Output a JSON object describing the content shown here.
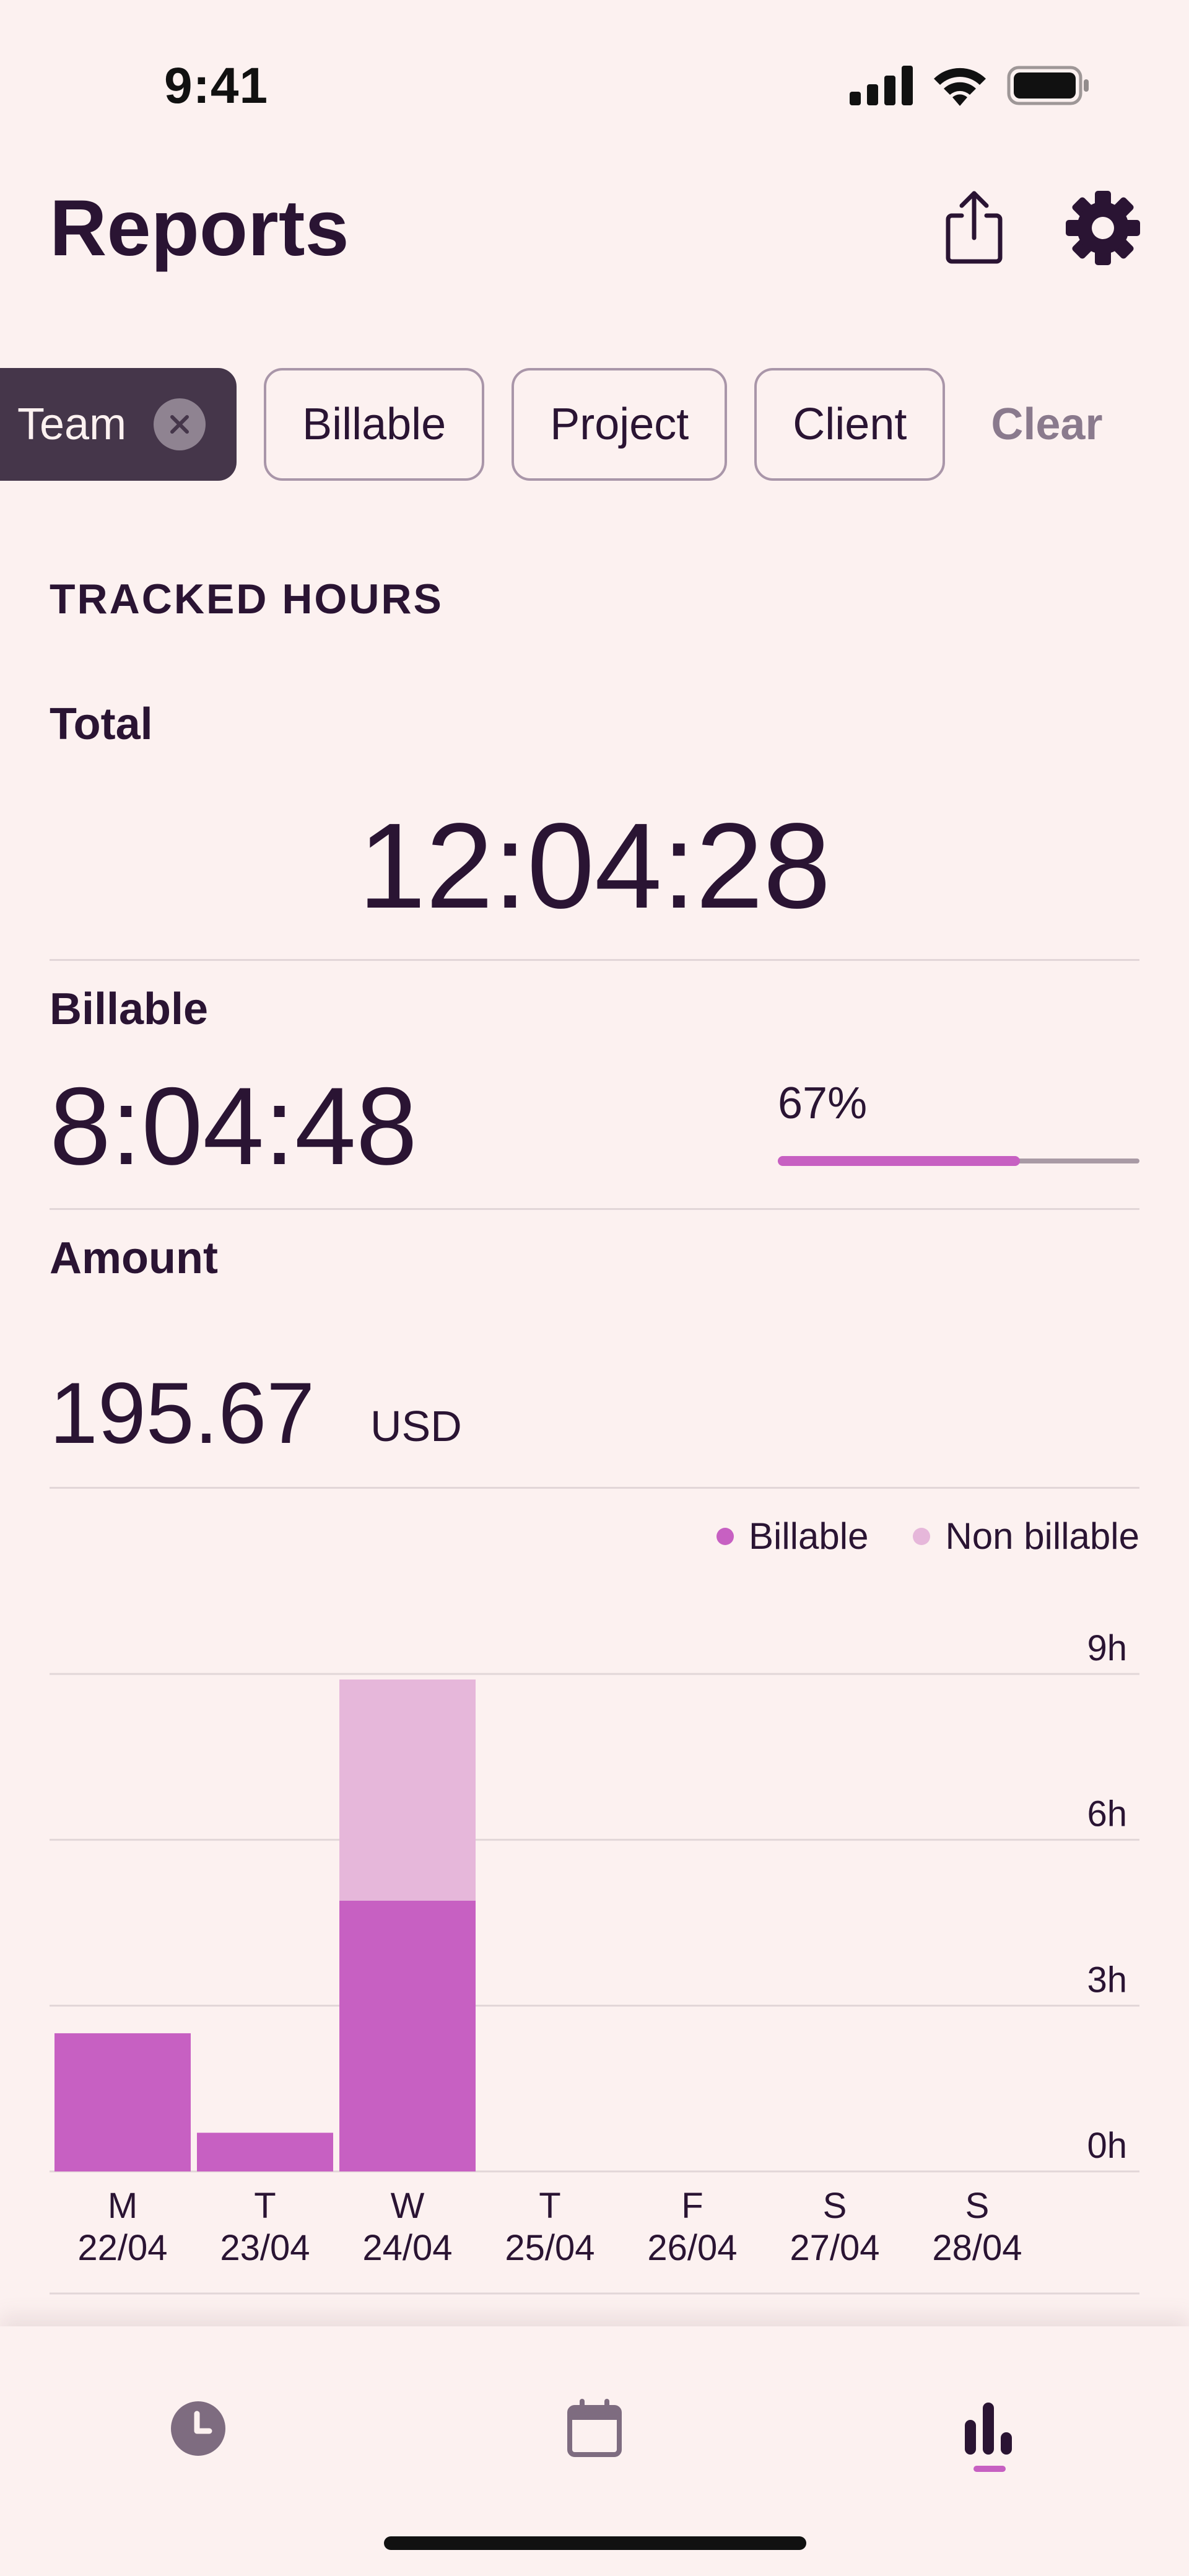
{
  "status_bar": {
    "time": "9:41"
  },
  "header": {
    "title": "Reports",
    "share_icon": "share-icon",
    "settings_icon": "gear-icon"
  },
  "filters": {
    "chips": [
      {
        "label": "Team",
        "active": true
      },
      {
        "label": "Billable",
        "active": false
      },
      {
        "label": "Project",
        "active": false
      },
      {
        "label": "Client",
        "active": false
      }
    ],
    "clear_label": "Clear"
  },
  "tracked_hours": {
    "section_title": "TRACKED HOURS",
    "total_label": "Total",
    "total_value": "12:04:28",
    "billable_label": "Billable",
    "billable_value": "8:04:48",
    "billable_percent_label": "67%",
    "billable_fraction": 0.67,
    "amount_label": "Amount",
    "amount_value": "195.67",
    "amount_currency": "USD"
  },
  "colors": {
    "background": "#FCF1F0",
    "text": "#2A1433",
    "billable": "#C760C2",
    "non_billable": "#E6B7DA",
    "chip_active": "#45364A"
  },
  "chart_data": {
    "type": "bar",
    "stacked": true,
    "categories": [
      "M\n22/04",
      "T\n23/04",
      "W\n24/04",
      "T\n25/04",
      "F\n26/04",
      "S\n27/04",
      "S\n28/04"
    ],
    "category_days": [
      "M",
      "T",
      "W",
      "T",
      "F",
      "S",
      "S"
    ],
    "category_dates": [
      "22/04",
      "23/04",
      "24/04",
      "25/04",
      "26/04",
      "27/04",
      "28/04"
    ],
    "series": [
      {
        "name": "Billable",
        "color": "#C760C2",
        "values": [
          2.5,
          0.7,
          4.9,
          0,
          0,
          0,
          0
        ]
      },
      {
        "name": "Non billable",
        "color": "#E6B7DA",
        "values": [
          0,
          0,
          4.0,
          0,
          0,
          0,
          0
        ]
      }
    ],
    "y_ticks": [
      "9h",
      "6h",
      "3h",
      "0h"
    ],
    "y_tick_values": [
      9,
      6,
      3,
      0
    ],
    "ylim": [
      0,
      9
    ],
    "grid": true,
    "legend_position": "top-right",
    "y_axis_position": "right"
  },
  "tabbar": {
    "items": [
      {
        "icon": "clock-icon",
        "active": false
      },
      {
        "icon": "calendar-icon",
        "active": false
      },
      {
        "icon": "bar-chart-icon",
        "active": true
      }
    ]
  }
}
